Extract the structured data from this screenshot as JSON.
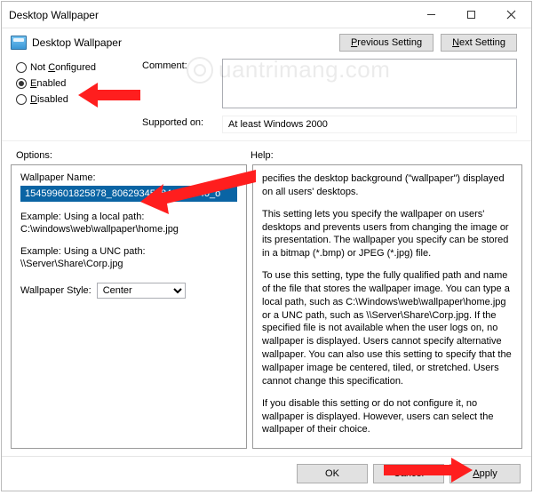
{
  "titlebar": {
    "title": "Desktop Wallpaper"
  },
  "header": {
    "title": "Desktop Wallpaper",
    "prev": "Previous Setting",
    "next": "Next Setting"
  },
  "state": {
    "not_configured": "Not Configured",
    "enabled": "Enabled",
    "disabled": "Disabled",
    "comment_label": "Comment:",
    "supported_label": "Supported on:",
    "supported_value": "At least Windows 2000"
  },
  "labels": {
    "options": "Options:",
    "help": "Help:"
  },
  "options": {
    "wallpaper_name_label": "Wallpaper Name:",
    "wallpaper_name_value": "154599601825878_806293454841707540_o",
    "example1_label": "Example: Using a local path:",
    "example1_value": "C:\\windows\\web\\wallpaper\\home.jpg",
    "example2_label": "Example: Using a UNC path:",
    "example2_value": "\\\\Server\\Share\\Corp.jpg",
    "style_label": "Wallpaper Style:",
    "style_value": "Center"
  },
  "help": {
    "p1": "pecifies the desktop background (\"wallpaper\") displayed on all users' desktops.",
    "p2": "This setting lets you specify the wallpaper on users' desktops and prevents users from changing the image or its presentation. The wallpaper you specify can be stored in a bitmap (*.bmp) or JPEG (*.jpg) file.",
    "p3": "To use this setting, type the fully qualified path and name of the file that stores the wallpaper image. You can type a local path, such as C:\\Windows\\web\\wallpaper\\home.jpg or a UNC path, such as \\\\Server\\Share\\Corp.jpg. If the specified file is not available when the user logs on, no wallpaper is displayed. Users cannot specify alternative wallpaper. You can also use this setting to specify that the wallpaper image be centered, tiled, or stretched. Users cannot change this specification.",
    "p4": "If you disable this setting or do not configure it, no wallpaper is displayed. However, users can select the wallpaper of their choice."
  },
  "footer": {
    "ok": "OK",
    "cancel": "Cancel",
    "apply": "Apply"
  },
  "watermark": "uantrimang.com"
}
